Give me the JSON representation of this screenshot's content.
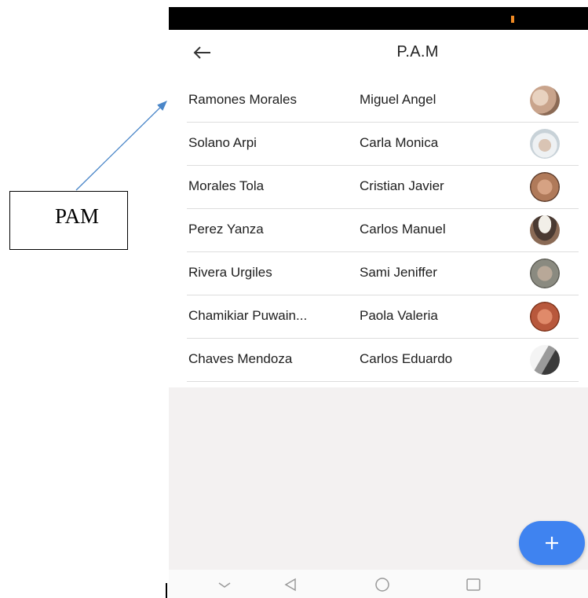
{
  "annotation": {
    "label": "PAM"
  },
  "appbar": {
    "title": "P.A.M"
  },
  "list": [
    {
      "surname": "Ramones Morales",
      "given": "Miguel Angel",
      "avatar_color": "#c9a48c"
    },
    {
      "surname": "Solano Arpi",
      "given": "Carla Monica",
      "avatar_color": "#c8d2d8"
    },
    {
      "surname": "Morales Tola",
      "given": "Cristian Javier",
      "avatar_color": "#b07a5a"
    },
    {
      "surname": "Perez Yanza",
      "given": "Carlos Manuel",
      "avatar_color": "#4a3a32"
    },
    {
      "surname": "Rivera Urgiles",
      "given": "Sami Jeniffer",
      "avatar_color": "#8a8a80"
    },
    {
      "surname": "Chamikiar Puwain...",
      "given": "Paola Valeria",
      "avatar_color": "#b8583c"
    },
    {
      "surname": "Chaves Mendoza",
      "given": "Carlos Eduardo",
      "avatar_color": "#9a9a9a"
    }
  ],
  "colors": {
    "fab": "#3f83f0",
    "status_accent": "#f08a24",
    "background": "#f3f1f1"
  },
  "icons": {
    "back": "arrow-left-icon",
    "fab": "plus-icon",
    "nav": [
      "chevron-down-icon",
      "triangle-back-icon",
      "circle-home-icon",
      "square-recents-icon"
    ]
  }
}
